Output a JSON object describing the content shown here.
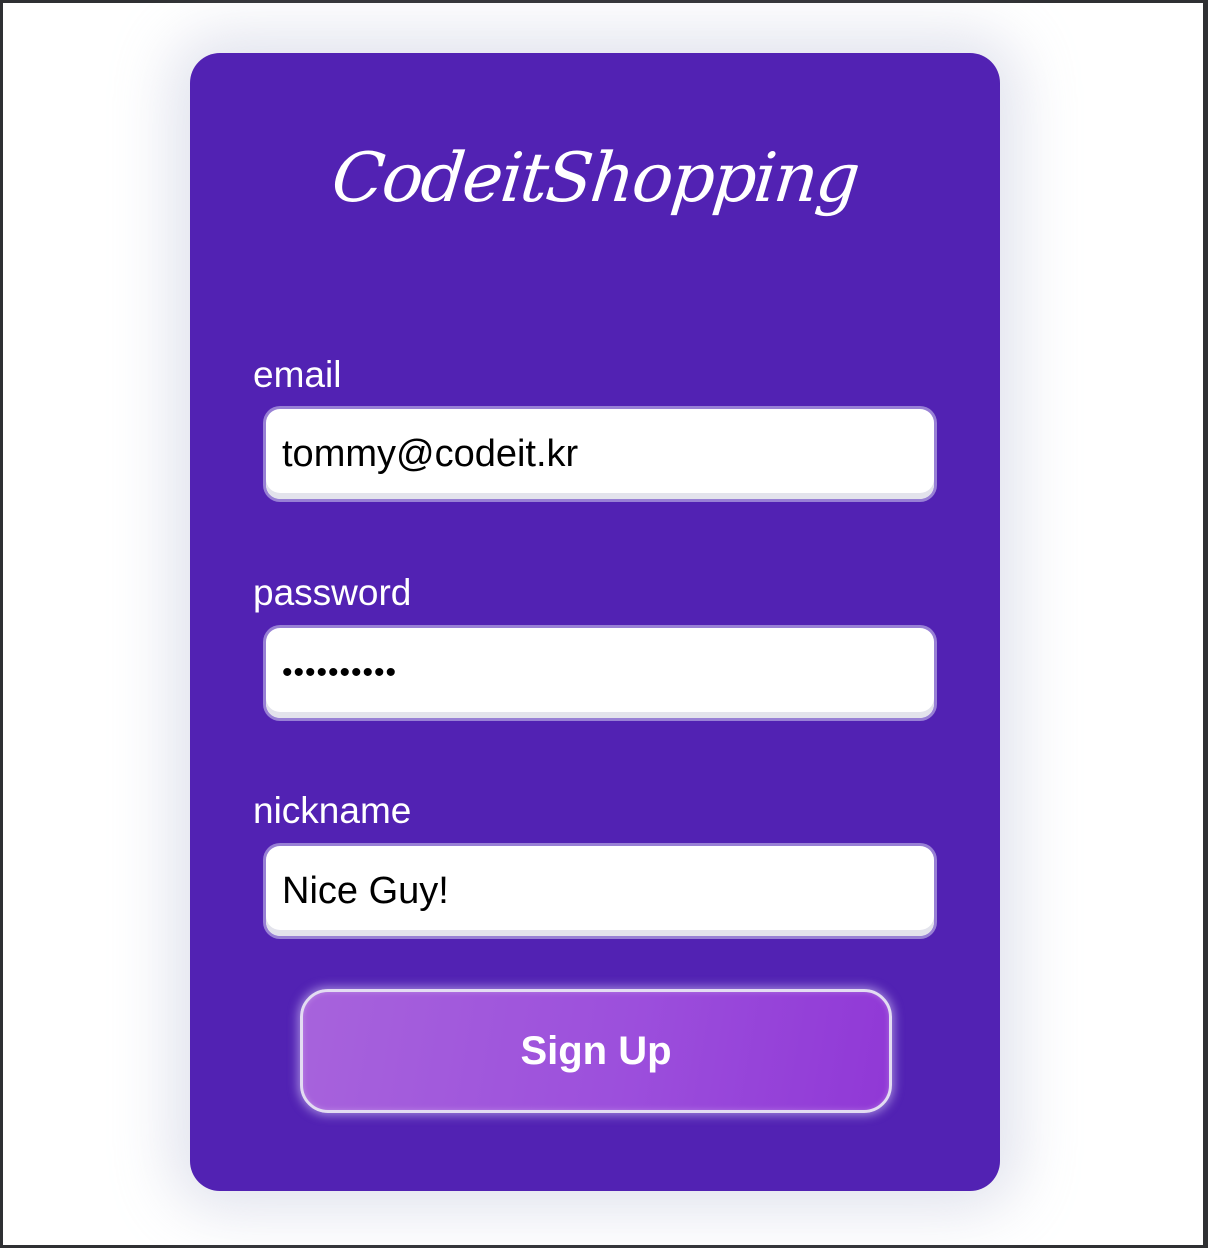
{
  "app": {
    "brand": "CodeitShopping"
  },
  "form": {
    "email": {
      "label": "email",
      "value": "tommy@codeit.kr"
    },
    "password": {
      "label": "password",
      "value": "••••••••••"
    },
    "nickname": {
      "label": "nickname",
      "value": "Nice Guy!"
    },
    "submit_label": "Sign Up"
  },
  "colors": {
    "card_background": "#5222b3",
    "button_gradient_start": "#a763dc",
    "button_gradient_end": "#9038d6",
    "text_on_card": "#ffffff"
  }
}
